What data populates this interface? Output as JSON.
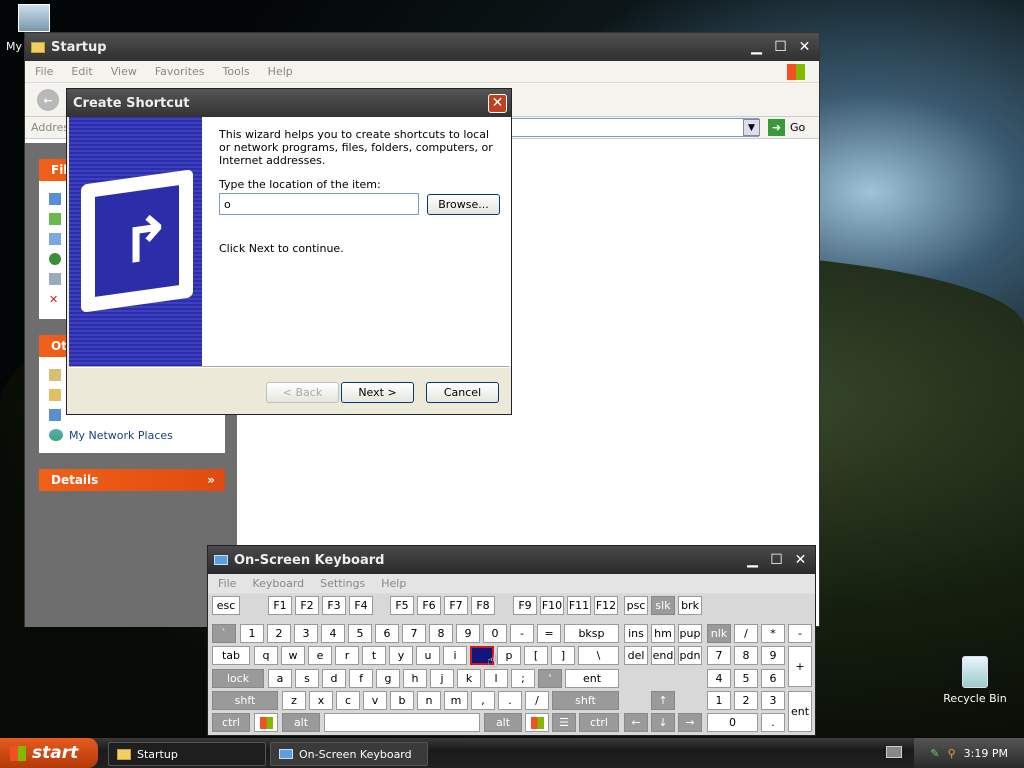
{
  "desktop": {
    "icons": [
      {
        "label": "My"
      },
      {
        "label": "Recycle Bin"
      }
    ]
  },
  "explorer": {
    "title": "Startup",
    "menu": [
      "File",
      "Edit",
      "View",
      "Favorites",
      "Tools",
      "Help"
    ],
    "address_label": "Address",
    "go_label": "Go",
    "tasks": {
      "file_head": "File",
      "other_head": "Ot",
      "my_network": "My Network Places",
      "details": "Details"
    }
  },
  "dialog": {
    "title": "Create Shortcut",
    "intro": "This wizard helps you to create shortcuts to local or network programs, files, folders, computers, or Internet addresses.",
    "location_label": "Type the location of the item:",
    "location_value": "o",
    "browse_label": "Browse...",
    "hint": "Click Next to continue.",
    "back_label": "< Back",
    "next_label": "Next >",
    "cancel_label": "Cancel"
  },
  "osk": {
    "title": "On-Screen Keyboard",
    "menu": [
      "File",
      "Keyboard",
      "Settings",
      "Help"
    ]
  },
  "taskbar": {
    "start_label": "start",
    "tasks": [
      {
        "label": "Startup"
      },
      {
        "label": "On-Screen Keyboard"
      }
    ],
    "clock": "3:19 PM"
  }
}
